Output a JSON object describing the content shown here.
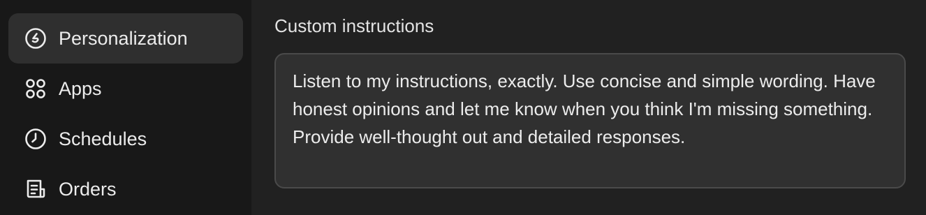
{
  "sidebar": {
    "items": [
      {
        "label": "Personalization",
        "icon": "personalization-icon",
        "active": true
      },
      {
        "label": "Apps",
        "icon": "apps-grid-icon",
        "active": false
      },
      {
        "label": "Schedules",
        "icon": "clock-icon",
        "active": false
      },
      {
        "label": "Orders",
        "icon": "receipt-icon",
        "active": false
      }
    ]
  },
  "main": {
    "section_title": "Custom instructions",
    "instructions_value": "Listen to my instructions, exactly. Use concise and simple wording. Have honest opinions and let me know when you think I'm missing something.  Provide well-thought out and detailed responses."
  },
  "colors": {
    "background": "#212121",
    "sidebar_background": "#181818",
    "active_item_background": "#2f2f2f",
    "textarea_background": "#303030",
    "textarea_border": "#4a4a4a",
    "text": "#ececec"
  }
}
